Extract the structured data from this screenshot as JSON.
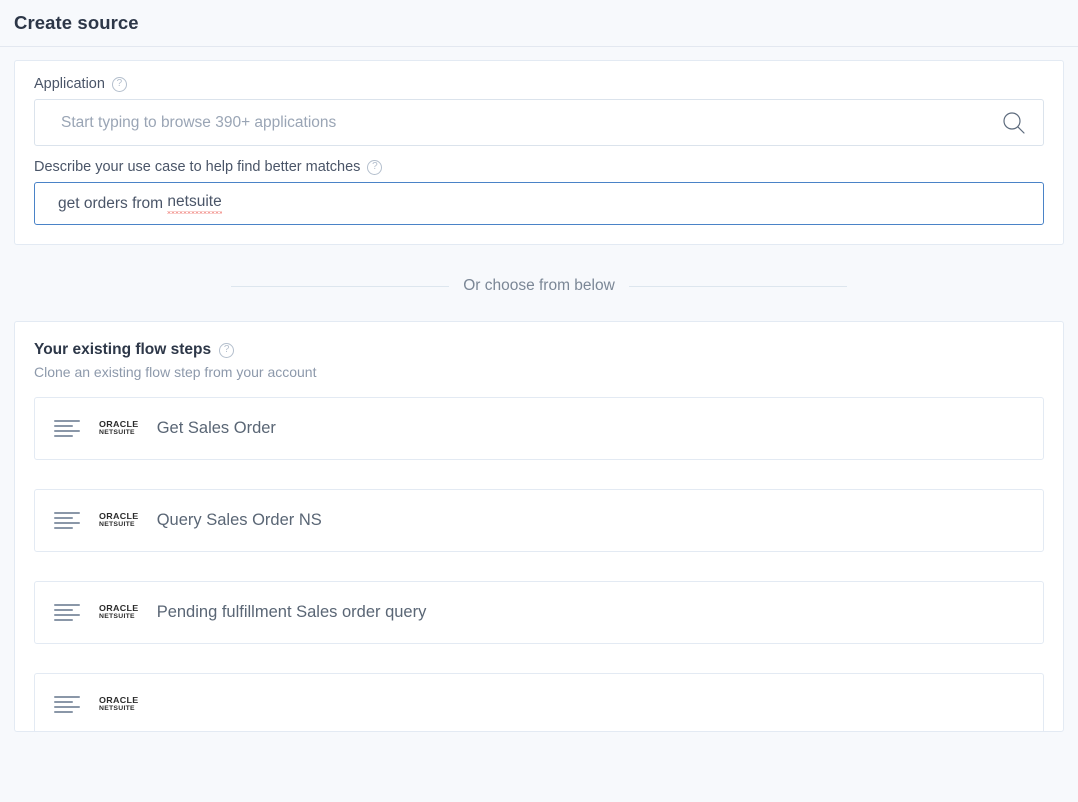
{
  "header": {
    "title": "Create source"
  },
  "search_card": {
    "application": {
      "label": "Application",
      "help_icon": "help-circle-icon",
      "placeholder": "Start typing to browse 390+ applications",
      "value": "",
      "search_icon": "search-icon"
    },
    "use_case": {
      "label": "Describe your use case to help find better matches",
      "help_icon": "help-circle-icon",
      "value": "get orders from netsuite",
      "value_prefix": "get orders from ",
      "value_misspelled": "netsuite",
      "spellcheck_color": "#e8443a",
      "focus_border_color": "#4a83c7"
    }
  },
  "divider": {
    "text": "Or choose from below"
  },
  "steps_card": {
    "title": "Your existing flow steps",
    "help_icon": "help-circle-icon",
    "subtitle": "Clone an existing flow step from your account",
    "items": [
      {
        "lines_icon": "lines-icon",
        "app_logo_line1": "ORACLE",
        "app_logo_line2": "NETSUITE",
        "name": "Get Sales Order"
      },
      {
        "lines_icon": "lines-icon",
        "app_logo_line1": "ORACLE",
        "app_logo_line2": "NETSUITE",
        "name": "Query Sales Order NS"
      },
      {
        "lines_icon": "lines-icon",
        "app_logo_line1": "ORACLE",
        "app_logo_line2": "NETSUITE",
        "name": "Pending fulfillment Sales order query"
      },
      {
        "lines_icon": "lines-icon",
        "app_logo_line1": "ORACLE",
        "app_logo_line2": "NETSUITE",
        "name": ""
      }
    ]
  },
  "colors": {
    "page_background": "#f7f9fc",
    "card_background": "#ffffff",
    "card_border": "#e3eaf3",
    "title_text": "#2d3748",
    "body_text": "#4a5568",
    "muted_text": "#8d99ab"
  }
}
